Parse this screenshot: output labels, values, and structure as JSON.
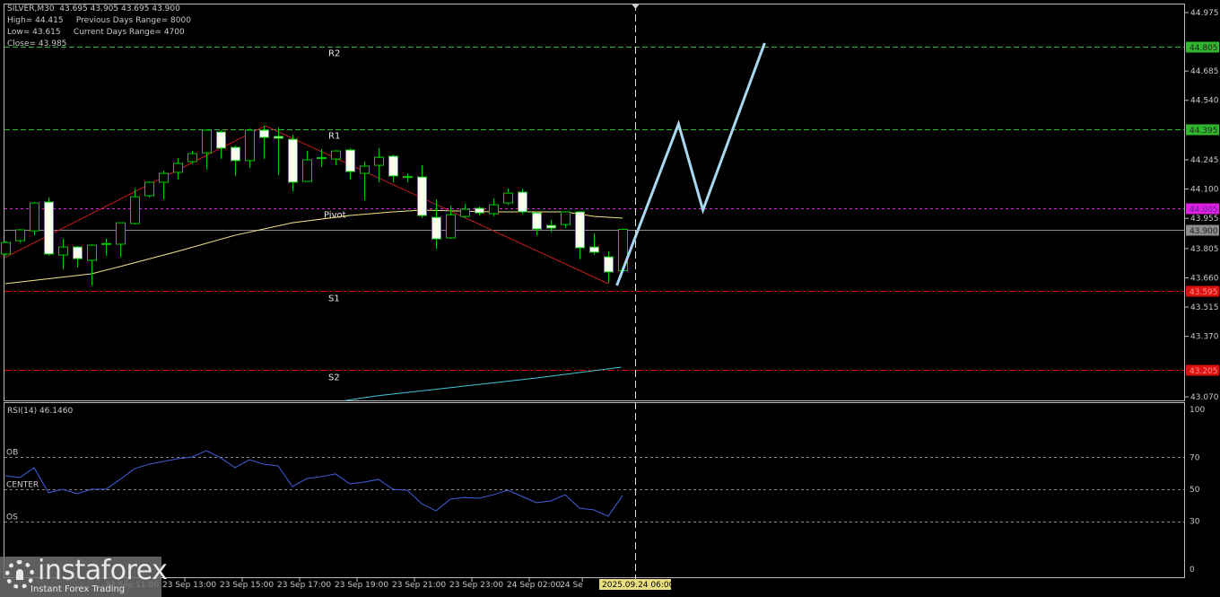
{
  "header": {
    "symbol_line": "SILVER,M30  43.695 43.905 43.695 43.900",
    "high_line": "High= 44.415     Previous Days Range= 8000",
    "low_line": "Low= 43.615     Current Days Range= 4700",
    "close_line": "Close= 43.985"
  },
  "watermark": {
    "name": "instaforex",
    "tagline": "Instant Forex Trading"
  },
  "colors": {
    "bull_outline": "#00c800",
    "bear_fill": "#ffffff",
    "resistance": "#3cb43c",
    "pivot": "#c800c8",
    "support": "#e01010",
    "current": "#a0a0a0",
    "ma_fast": "#f0e68c",
    "ma_slow": "#40c8d8",
    "trend": "#c81e1e",
    "forecast": "#a8d8f0",
    "rsi": "#4060e0"
  },
  "chart_data": {
    "type": "candlestick",
    "symbol": "SILVER",
    "timeframe": "M30",
    "ylim": [
      43.07,
      44.975
    ],
    "price_ticks": [
      "44.975",
      "44.685",
      "44.540",
      "44.245",
      "44.100",
      "43.955",
      "43.805",
      "43.660",
      "43.515",
      "43.370",
      "43.070"
    ],
    "levels": [
      {
        "name": "R2",
        "value": 44.805,
        "label": "44.805",
        "color": "#2fb82f",
        "kind": "res"
      },
      {
        "name": "R1",
        "value": 44.395,
        "label": "44.395",
        "color": "#2fb82f",
        "kind": "res"
      },
      {
        "name": "Pivot",
        "value": 44.005,
        "label": "44.005",
        "color": "#e020e0",
        "kind": "pivot"
      },
      {
        "name": "",
        "value": 43.9,
        "label": "43.900",
        "color": "#8c8c8c",
        "kind": "current"
      },
      {
        "name": "S1",
        "value": 43.595,
        "label": "43.595",
        "color": "#e01010",
        "kind": "sup"
      },
      {
        "name": "S2",
        "value": 43.205,
        "label": "43.205",
        "color": "#e01010",
        "kind": "sup"
      }
    ],
    "candles": [
      [
        43.778,
        43.844,
        43.769,
        43.835
      ],
      [
        43.844,
        43.902,
        43.835,
        43.898
      ],
      [
        43.893,
        44.036,
        43.871,
        44.031
      ],
      [
        44.036,
        44.058,
        43.769,
        43.778
      ],
      [
        43.773,
        43.853,
        43.702,
        43.813
      ],
      [
        43.813,
        43.818,
        43.711,
        43.755
      ],
      [
        43.747,
        43.827,
        43.622,
        43.822
      ],
      [
        43.827,
        43.853,
        43.769,
        43.83
      ],
      [
        43.827,
        43.933,
        43.764,
        43.933
      ],
      [
        43.929,
        44.102,
        43.924,
        44.062
      ],
      [
        44.067,
        44.138,
        44.058,
        44.134
      ],
      [
        44.134,
        44.192,
        44.049,
        44.178
      ],
      [
        44.183,
        44.254,
        44.147,
        44.227
      ],
      [
        44.236,
        44.289,
        44.227,
        44.276
      ],
      [
        44.28,
        44.396,
        44.196,
        44.392
      ],
      [
        44.383,
        44.392,
        44.249,
        44.303
      ],
      [
        44.307,
        44.316,
        44.165,
        44.241
      ],
      [
        44.241,
        44.401,
        44.205,
        44.392
      ],
      [
        44.392,
        44.414,
        44.249,
        44.356
      ],
      [
        44.361,
        44.405,
        44.169,
        44.352
      ],
      [
        44.347,
        44.37,
        44.089,
        44.134
      ],
      [
        44.138,
        44.289,
        44.138,
        44.245
      ],
      [
        44.254,
        44.298,
        44.209,
        44.256
      ],
      [
        44.249,
        44.294,
        44.218,
        44.289
      ],
      [
        44.294,
        44.303,
        44.147,
        44.187
      ],
      [
        44.178,
        44.236,
        44.045,
        44.214
      ],
      [
        44.218,
        44.303,
        44.134,
        44.258
      ],
      [
        44.263,
        44.272,
        44.134,
        44.165
      ],
      [
        44.16,
        44.178,
        44.134,
        44.162
      ],
      [
        44.16,
        44.218,
        43.956,
        43.969
      ],
      [
        43.96,
        44.049,
        43.804,
        43.853
      ],
      [
        43.858,
        44.018,
        43.853,
        43.973
      ],
      [
        43.964,
        44.027,
        43.956,
        44.0
      ],
      [
        44.005,
        44.014,
        43.969,
        43.982
      ],
      [
        43.978,
        44.054,
        43.964,
        44.022
      ],
      [
        44.031,
        44.102,
        44.022,
        44.08
      ],
      [
        44.085,
        44.102,
        43.978,
        43.987
      ],
      [
        43.982,
        43.987,
        43.871,
        43.902
      ],
      [
        43.92,
        43.947,
        43.884,
        43.907
      ],
      [
        43.924,
        43.991,
        43.907,
        43.987
      ],
      [
        43.987,
        43.991,
        43.751,
        43.809
      ],
      [
        43.813,
        43.88,
        43.773,
        43.787
      ],
      [
        43.764,
        43.791,
        43.634,
        43.689
      ],
      [
        43.695,
        43.905,
        43.695,
        43.9
      ]
    ],
    "ma_fast": [
      [
        0,
        43.631
      ],
      [
        6,
        43.68
      ],
      [
        8,
        43.716
      ],
      [
        12,
        43.791
      ],
      [
        16,
        43.871
      ],
      [
        20,
        43.933
      ],
      [
        24,
        43.969
      ],
      [
        27,
        43.987
      ],
      [
        29,
        43.996
      ],
      [
        34,
        43.987
      ],
      [
        39,
        43.987
      ],
      [
        41,
        43.965
      ],
      [
        43,
        43.956
      ]
    ],
    "ma_slow": [
      [
        23.7,
        43.052
      ],
      [
        25.9,
        43.075
      ],
      [
        30.9,
        43.115
      ],
      [
        37.1,
        43.164
      ],
      [
        42.9,
        43.217
      ]
    ],
    "trend_lines": [
      [
        [
          -0.06,
          43.76
        ],
        [
          18.1,
          44.414
        ]
      ],
      [
        [
          18.1,
          44.414
        ],
        [
          42,
          43.631
        ]
      ]
    ],
    "forecast": [
      [
        42.6,
        43.622
      ],
      [
        46.9,
        44.423
      ],
      [
        48.6,
        43.996
      ],
      [
        52.9,
        44.824
      ]
    ],
    "cursor_index": 43.9,
    "rsi": {
      "label": "RSI(14) 46.1460",
      "levels": [
        {
          "name": "OB",
          "value": 70
        },
        {
          "name": "CENTER",
          "value": 50
        },
        {
          "name": "OS",
          "value": 30
        }
      ],
      "ticks": [
        "100",
        "70",
        "50",
        "30",
        "0"
      ],
      "values": [
        58.4,
        57.3,
        63.5,
        47.8,
        50.0,
        47.2,
        50,
        50,
        56.2,
        62.9,
        65.7,
        67.4,
        69.1,
        70.2,
        74.2,
        69.7,
        63.5,
        68.5,
        65.7,
        64.6,
        51.7,
        56.7,
        57.9,
        59.6,
        53.4,
        54.5,
        56.2,
        50,
        49.4,
        41.0,
        36.5,
        43.8,
        44.9,
        44.4,
        46.6,
        49.4,
        45.5,
        41.6,
        42.7,
        46.6,
        38.2,
        37.1,
        33.1,
        46.1
      ]
    },
    "time_labels": [
      {
        "text": "23 Sep 11:00",
        "index": 8.5
      },
      {
        "text": "23 Sep 13:00",
        "index": 12.5
      },
      {
        "text": "23 Sep 15:00",
        "index": 16.5
      },
      {
        "text": "23 Sep 17:00",
        "index": 20.5
      },
      {
        "text": "23 Sep 19:00",
        "index": 24.5
      },
      {
        "text": "23 Sep 21:00",
        "index": 28.5
      },
      {
        "text": "23 Sep 23:00",
        "index": 32.5
      },
      {
        "text": "24 Sep 02:00",
        "index": 36.5
      },
      {
        "text": "24 Se",
        "index": 40.2
      }
    ],
    "cursor_time": "2025.09.24 06:00"
  }
}
